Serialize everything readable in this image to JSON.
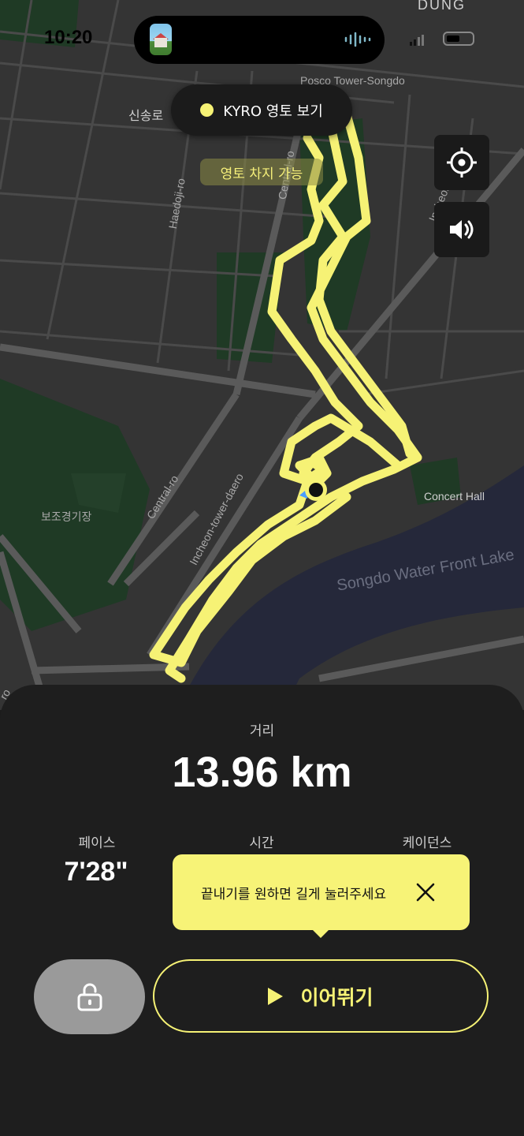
{
  "status_bar": {
    "time": "10:20"
  },
  "map": {
    "labels": {
      "dong": "DUNG",
      "posco": "Posco Tower-Songdo",
      "sinsongro": "신송로",
      "haedoji": "Haedoji-ro",
      "central_top": "Central-ro",
      "incheon_right": "Incheon-daero",
      "concert": "Concert Hall",
      "bojo": "보조경기장",
      "central_bottom": "Central-ro",
      "incheon_tower": "Incheon-tower-daero",
      "lake": "Songdo Water Front Lake",
      "ro": "ro"
    },
    "territory_button": "KYRO 영토 보기",
    "capture_badge": "영토 차지 가능"
  },
  "stats": {
    "distance_label": "거리",
    "distance_value": "13.96 km",
    "pace_label": "페이스",
    "pace_value": "7'28\"",
    "time_label": "시간",
    "cadence_label": "케이던스"
  },
  "tooltip": {
    "text": "끝내기를 원하면 길게 눌러주세요"
  },
  "actions": {
    "resume_label": "이어뛰기"
  },
  "colors": {
    "accent": "#f6f275",
    "map_bg": "#343434",
    "water": "#25283a",
    "park": "#1f3a25"
  }
}
